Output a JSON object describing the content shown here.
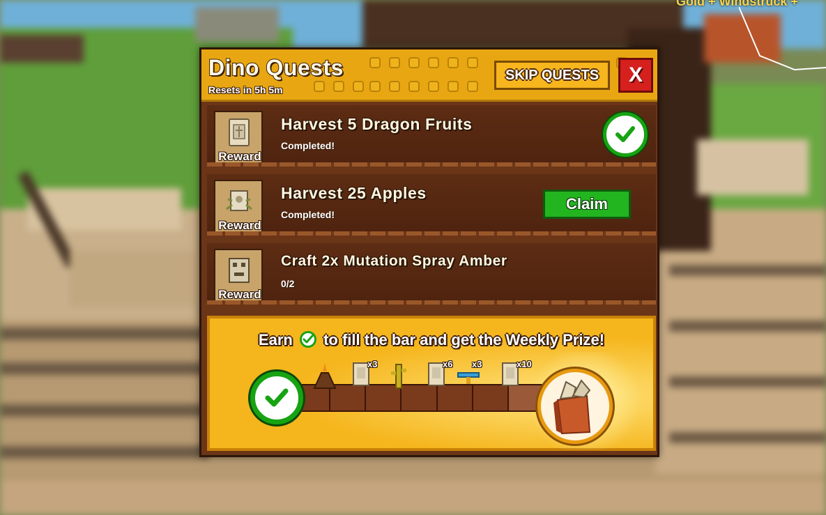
{
  "background": {
    "topright_text": "Gold + Windstruck +"
  },
  "panel": {
    "title": "Dino Quests",
    "reset_text": "Resets in 5h 5m",
    "skip_button_label": "SKIP QUESTS",
    "close_button_label": "X"
  },
  "quests": [
    {
      "name": "Harvest 5 Dragon Fruits",
      "status": "Completed!",
      "reward_label": "Reward",
      "reward_icon": "seed-pack-icon",
      "state": "done"
    },
    {
      "name": "Harvest 25 Apples",
      "status": "Completed!",
      "reward_label": "Reward",
      "reward_icon": "crate-icon",
      "state": "claimable",
      "claim_label": "Claim"
    },
    {
      "name": "Craft 2x Mutation Spray Amber",
      "status": "0/2",
      "reward_label": "Reward",
      "reward_icon": "totem-icon",
      "state": "in-progress"
    }
  ],
  "weekly": {
    "text_before": "Earn",
    "text_after": "to fill the bar and get the Weekly Prize!",
    "progress_fraction": 0,
    "milestones": [
      {
        "icon": "volcano-icon",
        "count": ""
      },
      {
        "icon": "seed-pack-icon",
        "count": "x3"
      },
      {
        "icon": "cactus-icon",
        "count": ""
      },
      {
        "icon": "seed-pack-icon",
        "count": "x6"
      },
      {
        "icon": "sprinkler-icon",
        "count": "x3"
      },
      {
        "icon": "seed-pack-icon",
        "count": "x10"
      }
    ],
    "prize_icon": "gift-bag-icon"
  },
  "colors": {
    "header_gold": "#e8a712",
    "panel_brown": "#6b3518",
    "check_green": "#17a312",
    "close_red": "#d6201e"
  }
}
